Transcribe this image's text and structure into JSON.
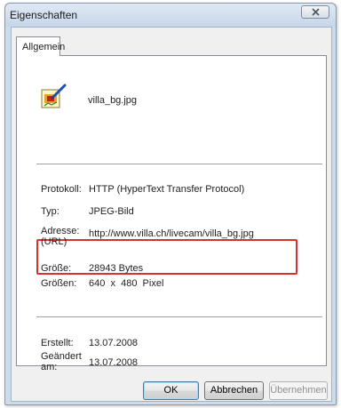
{
  "window": {
    "title": "Eigenschaften"
  },
  "tabs": [
    {
      "label": "Allgemein"
    }
  ],
  "file": {
    "name": "villa_bg.jpg",
    "icon": "image-file-icon"
  },
  "properties": {
    "protocol": {
      "label": "Protokoll:",
      "value": "HTTP (HyperText Transfer Protocol)"
    },
    "type": {
      "label": "Typ:",
      "value": "JPEG-Bild"
    },
    "address": {
      "label_line1": "Adresse:",
      "label_line2": "(URL)",
      "value": "http://www.villa.ch/livecam/villa_bg.jpg"
    },
    "size": {
      "label": "Größe:",
      "value": "28943 Bytes"
    },
    "dimensions": {
      "label": "Größen:",
      "value": "640  x  480  Pixel"
    },
    "created": {
      "label": "Erstellt:",
      "value": "13.07.2008"
    },
    "modified": {
      "label_line1": "Geändert",
      "label_line2": "am:",
      "value": "13.07.2008"
    }
  },
  "buttons": {
    "ok": "OK",
    "cancel": "Abbrechen",
    "apply": "Übernehmen"
  },
  "colors": {
    "highlight_border": "#d93030",
    "dialog_frame": "#cddcea"
  }
}
